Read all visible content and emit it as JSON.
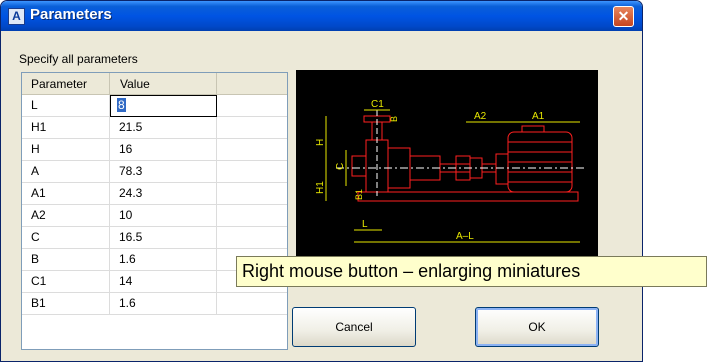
{
  "window": {
    "title": "Parameters",
    "app_icon_letter": "A"
  },
  "instruction": "Specify all parameters",
  "grid": {
    "headers": [
      "Parameter",
      "Value"
    ],
    "rows": [
      {
        "param": "L",
        "value": "8"
      },
      {
        "param": "H1",
        "value": "21.5"
      },
      {
        "param": "H",
        "value": "16"
      },
      {
        "param": "A",
        "value": "78.3"
      },
      {
        "param": "A1",
        "value": "24.3"
      },
      {
        "param": "A2",
        "value": "10"
      },
      {
        "param": "C",
        "value": "16.5"
      },
      {
        "param": "B",
        "value": "1.6"
      },
      {
        "param": "C1",
        "value": "14"
      },
      {
        "param": "B1",
        "value": "1.6"
      }
    ]
  },
  "preview": {
    "labels": {
      "c1": "C1",
      "b": "B",
      "a2": "A2",
      "a1": "A1",
      "h": "H",
      "c": "C",
      "h1": "H1",
      "b1": "B1",
      "l": "L",
      "a_l": "A–L"
    },
    "colors": {
      "background": "#000000",
      "drawing": "#ff2020",
      "dimensions": "#e8e800",
      "centerline": "#ffffff"
    }
  },
  "tooltip": "Right mouse button – enlarging miniatures",
  "buttons": {
    "cancel": "Cancel",
    "ok": "OK"
  }
}
